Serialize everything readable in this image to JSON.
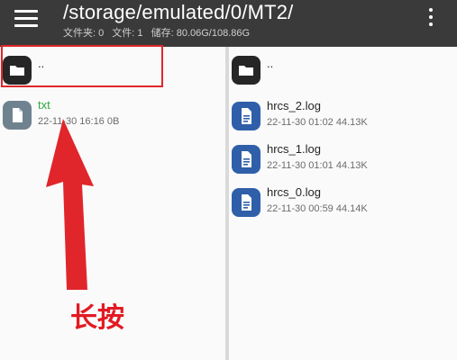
{
  "header": {
    "title": "/storage/emulated/0/MT2/",
    "folders": "文件夹: 0",
    "files": "文件: 1",
    "storage": "储存: 80.06G/108.86G",
    "icons": [
      "menu-icon",
      "more-vert-icon"
    ]
  },
  "left_pane": {
    "parent": {
      "name": "..",
      "icon": "folder-icon"
    },
    "items": [
      {
        "name": "txt",
        "meta": "22-11-30 16:16  0B",
        "icon": "file-icon",
        "color": "#2eaa3c"
      }
    ]
  },
  "right_pane": {
    "parent": {
      "name": "..",
      "icon": "folder-icon"
    },
    "items": [
      {
        "name": "hrcs_2.log",
        "meta": "22-11-30 01:02  44.13K",
        "icon": "document-icon"
      },
      {
        "name": "hrcs_1.log",
        "meta": "22-11-30 01:01  44.13K",
        "icon": "document-icon"
      },
      {
        "name": "hrcs_0.log",
        "meta": "22-11-30 00:59  44.14K",
        "icon": "document-icon"
      }
    ]
  },
  "annotation": {
    "text": "长按",
    "color": "#e21a22"
  },
  "colors": {
    "appbar": "#3a3a3a",
    "log_icon": "#2f5fa8",
    "highlight": "#e0262b"
  }
}
